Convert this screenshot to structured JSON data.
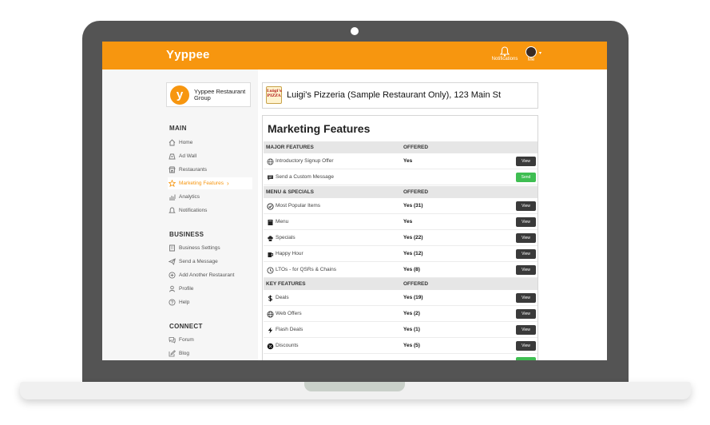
{
  "app": {
    "brand": "Yyppee"
  },
  "header": {
    "notifications_label": "Notifications",
    "me_label": "Me",
    "me_caret": "▾"
  },
  "org": {
    "logo_letter": "y",
    "name": "Yyppee Restaurant Group"
  },
  "sidebar": {
    "main_title": "MAIN",
    "main_items": [
      {
        "label": "Home",
        "icon": "home-icon"
      },
      {
        "label": "Ad Wall",
        "icon": "ad-wall-icon"
      },
      {
        "label": "Restaurants",
        "icon": "store-icon"
      },
      {
        "label": "Marketing Features",
        "icon": "star-icon",
        "active": true
      },
      {
        "label": "Analytics",
        "icon": "chart-icon"
      },
      {
        "label": "Notifications",
        "icon": "bell-icon"
      }
    ],
    "business_title": "BUSINESS",
    "business_items": [
      {
        "label": "Business Settings",
        "icon": "building-icon"
      },
      {
        "label": "Send a Message",
        "icon": "paper-plane-icon"
      },
      {
        "label": "Add Another Restaurant",
        "icon": "plus-circle-icon"
      },
      {
        "label": "Profile",
        "icon": "user-icon"
      },
      {
        "label": "Help",
        "icon": "question-icon"
      }
    ],
    "connect_title": "CONNECT",
    "connect_items": [
      {
        "label": "Forum",
        "icon": "forum-icon"
      },
      {
        "label": "Blog",
        "icon": "blog-icon"
      }
    ],
    "active_chevron": "›"
  },
  "restaurant": {
    "logo_text": "Luigi's PIZZA",
    "name": "Luigi's Pizzeria (Sample Restaurant Only), 123 Main St"
  },
  "panel": {
    "title": "Marketing Features",
    "offered_header": "OFFERED",
    "sections": [
      {
        "title": "MAJOR FEATURES",
        "rows": [
          {
            "name": "Introductory Signup Offer",
            "status": "Yes",
            "button": "View",
            "icon": "globe-icon"
          },
          {
            "name": "Send a Custom Message",
            "status": "",
            "button": "Send",
            "icon": "message-icon"
          }
        ]
      },
      {
        "title": "MENU & SPECIALS",
        "rows": [
          {
            "name": "Most Popular Items",
            "status": "Yes (31)",
            "button": "View",
            "icon": "check-circle-icon"
          },
          {
            "name": "Menu",
            "status": "Yes",
            "button": "View",
            "icon": "book-icon"
          },
          {
            "name": "Specials",
            "status": "Yes (22)",
            "button": "View",
            "icon": "chef-hat-icon"
          },
          {
            "name": "Happy Hour",
            "status": "Yes (12)",
            "button": "View",
            "icon": "beer-icon"
          },
          {
            "name": "LTOs - for QSRs & Chains",
            "status": "Yes (8)",
            "button": "View",
            "icon": "clock-icon"
          }
        ]
      },
      {
        "title": "KEY FEATURES",
        "rows": [
          {
            "name": "Deals",
            "status": "Yes (19)",
            "button": "View",
            "icon": "dollar-icon"
          },
          {
            "name": "Web Offers",
            "status": "Yes (2)",
            "button": "View",
            "icon": "globe-icon"
          },
          {
            "name": "Flash Deals",
            "status": "Yes (1)",
            "button": "View",
            "icon": "lightning-icon"
          },
          {
            "name": "Discounts",
            "status": "Yes (5)",
            "button": "View",
            "icon": "percent-icon"
          }
        ]
      }
    ]
  },
  "colors": {
    "brand_orange": "#f7960f",
    "view_button": "#3a3a3a",
    "send_button": "#3fbe52",
    "laptop_frame": "#545454"
  }
}
